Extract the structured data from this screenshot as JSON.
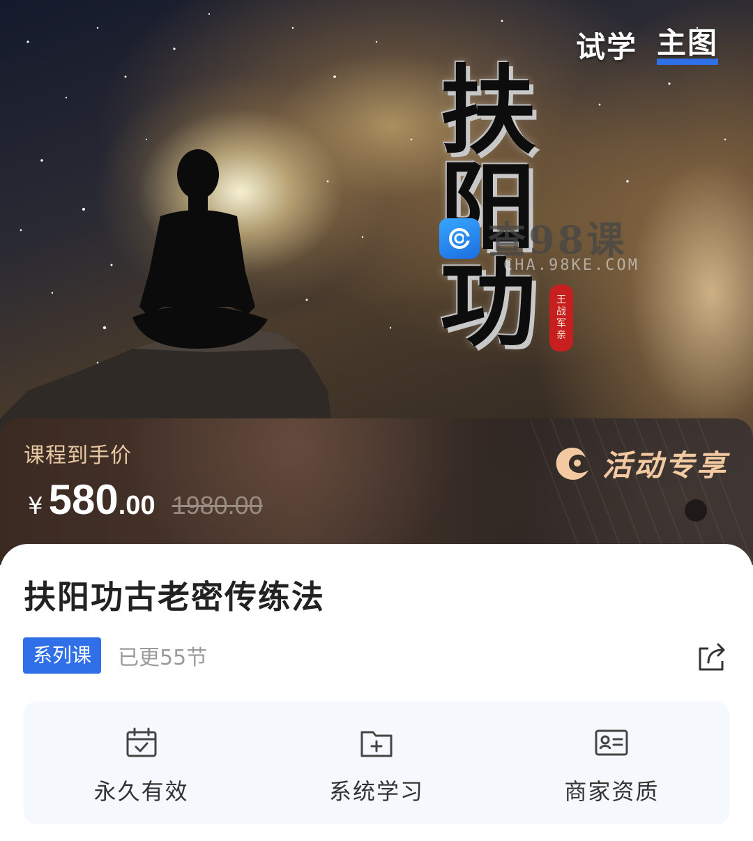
{
  "hero": {
    "tabs": [
      {
        "label": "试学",
        "active": false
      },
      {
        "label": "主图",
        "active": true
      }
    ],
    "poster_title_chars": [
      "扶",
      "阳",
      "功"
    ],
    "seal_text": "王战军亲",
    "watermark_text": "查98课",
    "watermark_url": "CHA.98KE.COM",
    "tab_accent_color": "#2f6fe8"
  },
  "price": {
    "label": "课程到手价",
    "currency": "¥",
    "current_int": "580",
    "current_dec": ".00",
    "original": "1980.00",
    "activity_label": "活动专享",
    "activity_color": "#f2c9a0"
  },
  "course": {
    "title": "扶阳功古老密传练法",
    "tag": "系列课",
    "tag_color": "#2f6fe8",
    "update_text": "已更55节",
    "share_icon": "share-icon"
  },
  "features": [
    {
      "icon": "calendar-check-icon",
      "label": "永久有效"
    },
    {
      "icon": "folder-plus-icon",
      "label": "系统学习"
    },
    {
      "icon": "id-card-icon",
      "label": "商家资质"
    }
  ]
}
